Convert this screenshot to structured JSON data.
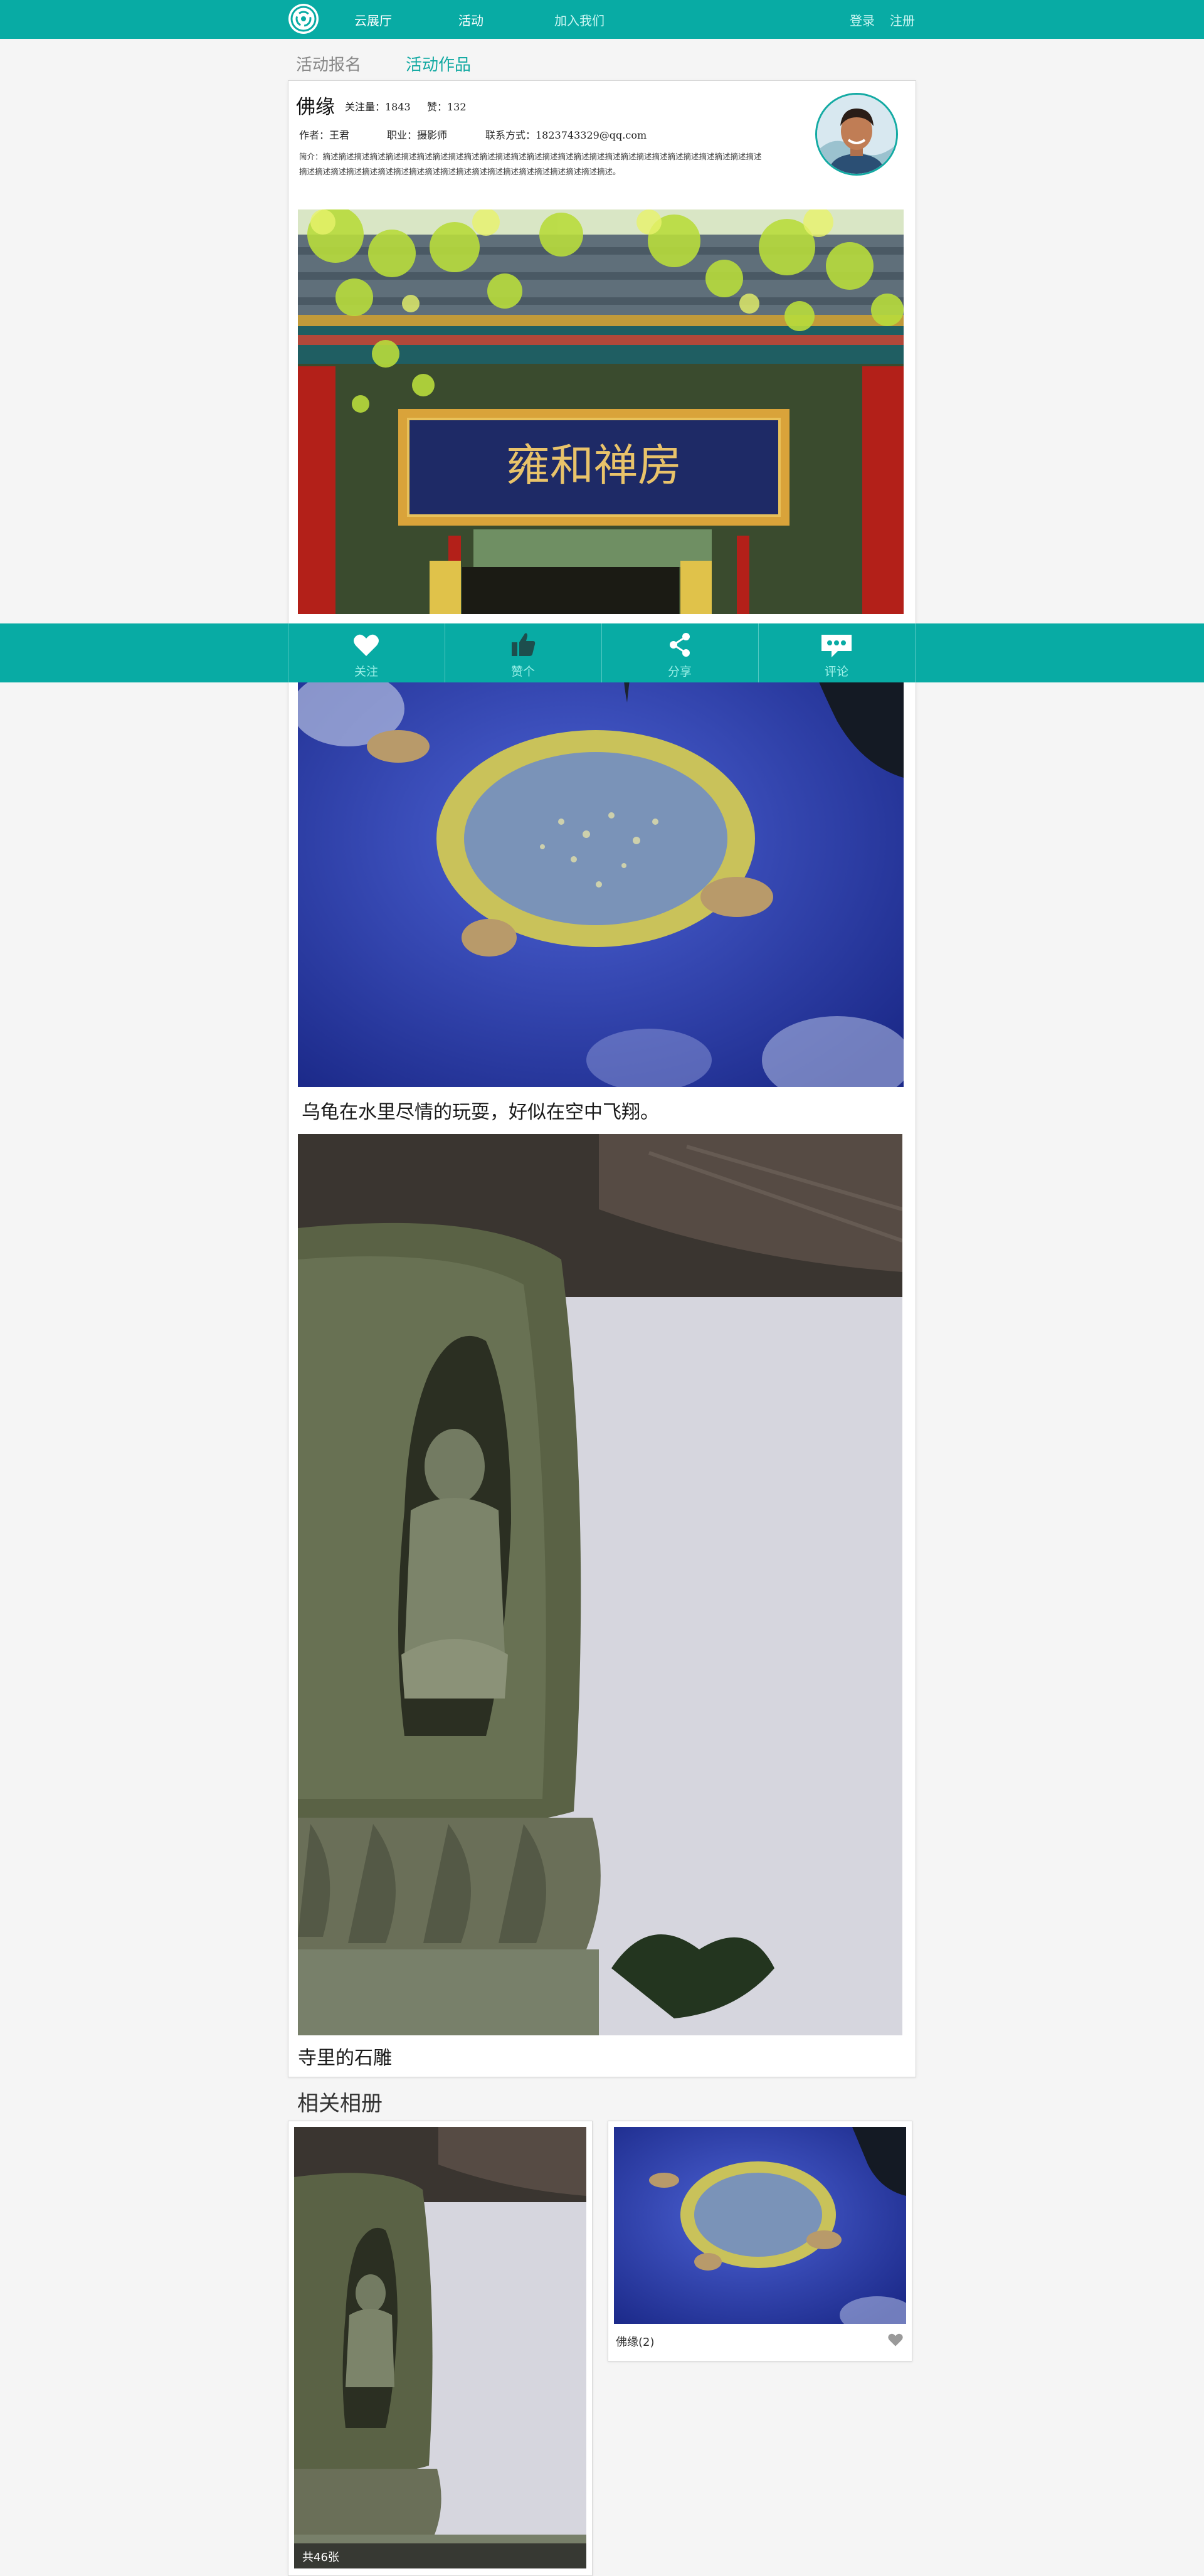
{
  "nav": {
    "items": [
      "云展厅",
      "活动",
      "加入我们"
    ],
    "login": "登录",
    "register": "注册"
  },
  "tabs": [
    "活动报名",
    "活动作品"
  ],
  "author": {
    "name": "佛缘",
    "followers": "关注量：1843",
    "likes": "赞：132",
    "author_line": "作者：王君",
    "job_line": "职业：摄影师",
    "contact_line": "联系方式：1823743329@qq.com",
    "intro": "简介：摘述摘述摘述摘述摘述摘述摘述摘述摘述摘述摘述摘述摘述摘述摘述摘述摘述摘述摘述摘述摘述摘述摘述摘述摘述摘述摘述摘述摘述摘述摘述摘述摘述摘述摘述摘述摘述摘述摘述摘述摘述摘述摘述摘述摘述摘述摘述摘述。"
  },
  "photos": {
    "plaque_text": "雍和禅房",
    "caption_turtles": "乌龟在水里尽情的玩耍，好似在空中飞翔。",
    "caption_statue": "寺里的石雕"
  },
  "actions": [
    {
      "label": "关注",
      "icon": "heart-icon"
    },
    {
      "label": "赞个",
      "icon": "thumbs-up-icon"
    },
    {
      "label": "分享",
      "icon": "share-icon"
    },
    {
      "label": "评论",
      "icon": "comment-icon"
    }
  ],
  "related": {
    "title": "相关相册",
    "albums": [
      {
        "count_label": "共46张"
      },
      {
        "name": "佛缘(2)"
      }
    ]
  },
  "colors": {
    "accent": "#08aba4",
    "accent_text": "#12a9a2",
    "action_label": "#9cf0e8",
    "page_bg": "#f5f5f5"
  }
}
